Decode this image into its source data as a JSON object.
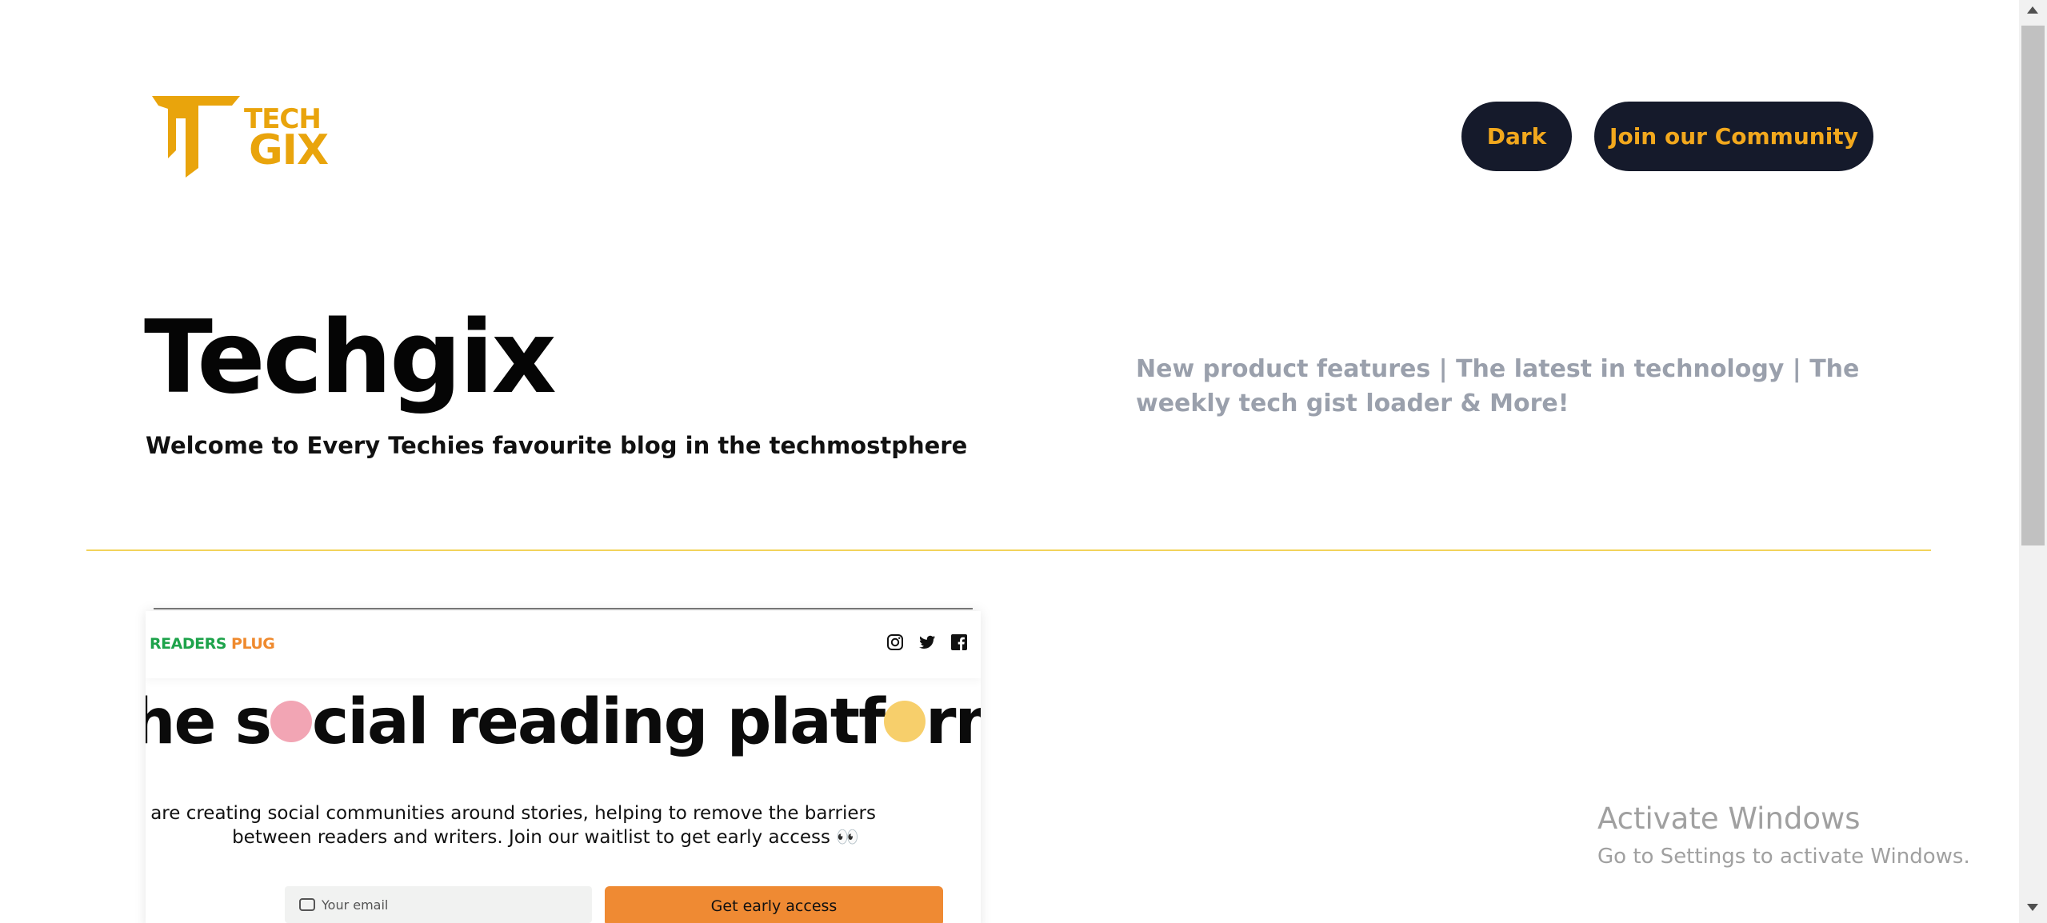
{
  "header": {
    "logo": {
      "line1": "TECH",
      "line2": "GIX",
      "color": "#e9a40c"
    },
    "dark_button": "Dark",
    "join_button": "Join our Community",
    "button_bg": "#151a2b",
    "button_text_color": "#f2a81d"
  },
  "hero": {
    "title": "Techgix",
    "subtitle": "Welcome to Every Techies favourite blog in the techmostphere",
    "tagline": "New product features | The latest in technology | The weekly tech gist loader & More!"
  },
  "card": {
    "brand_part1": "READERS",
    "brand_part2": "PLUG",
    "socials": [
      "instagram-icon",
      "twitter-icon",
      "facebook-icon"
    ],
    "headline_a": "he s",
    "headline_b": "cial reading platf",
    "headline_c": "rm",
    "description_line1": "/e are creating social communities around stories, helping to remove the barriers",
    "description_line2": "between readers and writers. Join our waitlist to get early access 👀",
    "email_placeholder": "Your email",
    "cta": "Get early access"
  },
  "windows": {
    "line1": "Activate Windows",
    "line2": "Go to Settings to activate Windows."
  }
}
